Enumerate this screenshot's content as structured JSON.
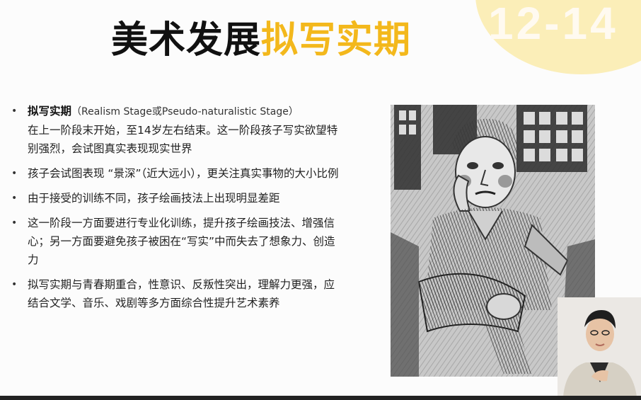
{
  "title": {
    "part1": "美术发展",
    "part2": "拟写实期"
  },
  "age_badge": "12-14",
  "bullets": [
    {
      "strong": "拟写实期",
      "english": "（Realism Stage或Pseudo-naturalistic Stage）",
      "text": "在上一阶段末开始，至14岁左右结束。这一阶段孩子写实欲望特别强烈，会试图真实表现现实世界"
    },
    {
      "text": "孩子会试图表现 “景深”（近大远小），更关注真实事物的大小比例"
    },
    {
      "text": "由于接受的训练不同，孩子绘画技法上出现明显差距"
    },
    {
      "text": "这一阶段一方面要进行专业化训练，提升孩子绘画技法、增强信心；另一方面要避免孩子被困在“写实”中而失去了想象力、创造力"
    },
    {
      "text": "拟写实期与青春期重合，性意识、反叛性突出，理解力更强，应结合文学、音乐、戏剧等多方面综合性提升艺术素养"
    }
  ],
  "colors": {
    "accent": "#f3b81c",
    "circle": "#fbeeb8",
    "title": "#111111"
  },
  "images": {
    "drawing": "charcoal-portrait-seated-boy",
    "presenter": "presenter-video-overlay"
  }
}
